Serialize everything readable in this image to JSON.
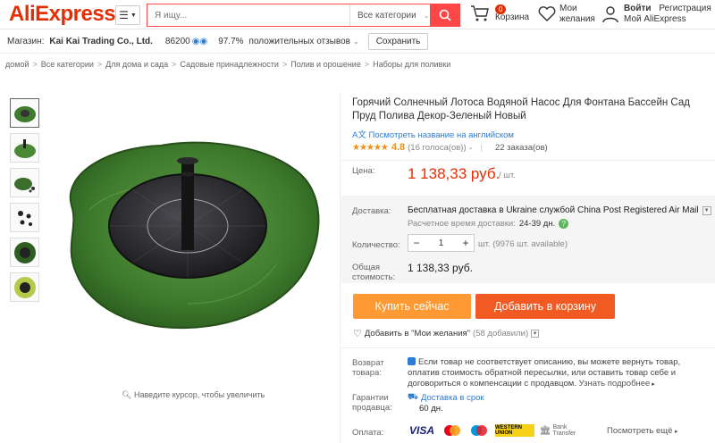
{
  "header": {
    "logo": "AliExpress",
    "search_placeholder": "Я ищу...",
    "search_category": "Все категории",
    "cart_count": "0",
    "cart_label": "Корзина",
    "wish_line1": "Мои",
    "wish_line2": "желания",
    "login": "Войти",
    "register": "Регистрация",
    "my_ali": "Мой AliExpress"
  },
  "store": {
    "label": "Магазин:",
    "name": "Kai Kai Trading Co., Ltd.",
    "score": "86200",
    "positive": "97.7%",
    "positive_label": "положительных отзывов",
    "save": "Сохранить"
  },
  "breadcrumb": [
    "домой",
    "Все категории",
    "Для дома и сада",
    "Садовые принадлежности",
    "Полив и орошение",
    "Наборы для поливки"
  ],
  "gallery": {
    "zoom_hint": "Наведите курсор, чтобы увеличить"
  },
  "product": {
    "title": "Горячий Солнечный Лотоса Водяной Насос Для Фонтана Бассейн Сад Пруд Полива Декор-Зеленый Новый",
    "translate": "Посмотреть название на английском",
    "rating": "4.8",
    "votes": "(16 голоса(ов))",
    "orders": "22 заказа(ов)",
    "price_label": "Цена:",
    "price": "1 138,33 руб.",
    "price_unit": "/ шт.",
    "delivery_label": "Доставка:",
    "delivery": "Бесплатная доставка в Ukraine службой China Post Registered Air Mail",
    "delivery_time_label": "Расчетное время доставки:",
    "delivery_time": "24-39 дн.",
    "qty_label": "Количество:",
    "qty": "1",
    "qty_avail": "шт. (9976 шт. available)",
    "total_label1": "Общая",
    "total_label2": "стоимость:",
    "total": "1 138,33 руб.",
    "buy_now": "Купить сейчас",
    "add_cart": "Добавить в корзину",
    "wish_add": "Добавить в \"Мои желания\"",
    "wish_count": "(58 добавили)",
    "return_label1": "Возврат",
    "return_label2": "товара:",
    "return_text": "Если товар не соответствует описанию, вы можете вернуть товар, оплатив стоимость обратной пересылки, или оставить товар себе и договориться о компенсации с продавцом.",
    "return_more": "Узнать подробнее",
    "guarantee_label1": "Гарантии",
    "guarantee_label2": "продавца:",
    "guarantee1": "Доставка в срок",
    "guarantee2": "60 дн.",
    "payment_label": "Оплата:",
    "pay_visa": "VISA",
    "pay_wu": "WESTERN UNION",
    "pay_bank": "Bank Transfer",
    "pay_more": "Посмотреть ещё"
  }
}
